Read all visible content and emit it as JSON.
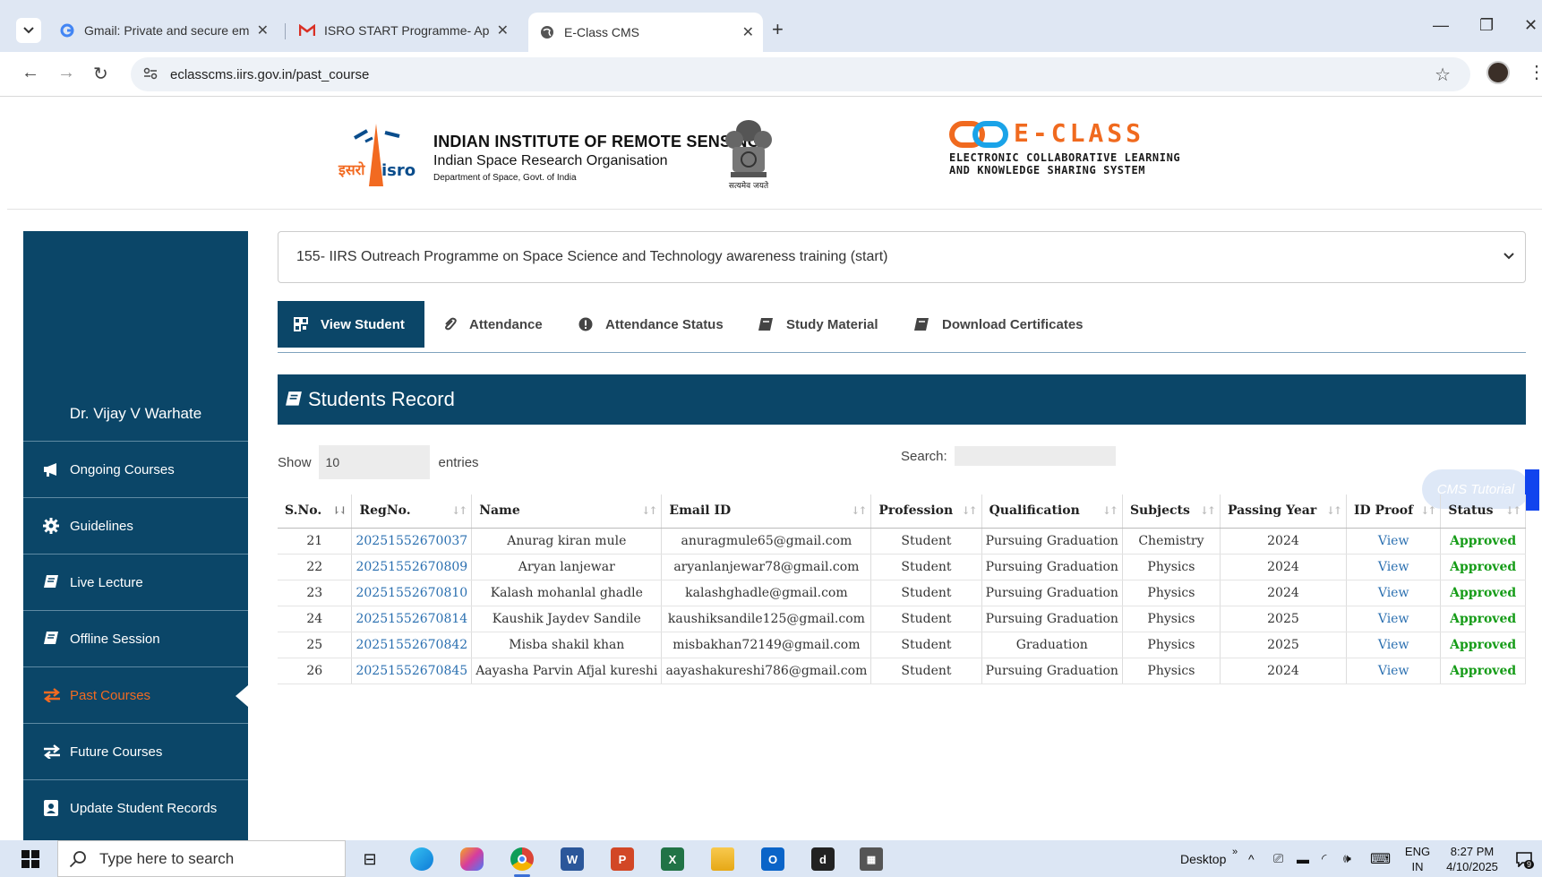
{
  "browser": {
    "tabs": [
      {
        "label": "Gmail: Private and secure email",
        "favicon": "google-icon"
      },
      {
        "label": "ISRO START Programme- Approval",
        "favicon": "gmail-icon"
      },
      {
        "label": "E-Class CMS",
        "favicon": "globe-icon"
      }
    ],
    "url": "eclasscms.iirs.gov.in/past_course"
  },
  "header": {
    "isro_hindi": "इसरो",
    "isro_latin": "isro",
    "institute": "INDIAN INSTITUTE OF REMOTE SENSING",
    "org": "Indian Space Research Organisation",
    "dept": "Department of Space, Govt. of India",
    "emblem_motto": "सत्यमेव जयते",
    "eclass_title": "E-CLASS",
    "eclass_sub1": "ELECTRONIC COLLABORATIVE LEARNING",
    "eclass_sub2": "AND KNOWLEDGE SHARING SYSTEM"
  },
  "sidebar": {
    "user": "Dr. Vijay V Warhate",
    "items": [
      {
        "label": "Ongoing Courses"
      },
      {
        "label": "Guidelines"
      },
      {
        "label": "Live Lecture"
      },
      {
        "label": "Offline Session"
      },
      {
        "label": "Past Courses"
      },
      {
        "label": "Future Courses"
      },
      {
        "label": "Update Student Records"
      }
    ]
  },
  "course_select": {
    "selected": "155- IIRS Outreach Programme on Space Science and Technology awareness training (start)"
  },
  "tabs": [
    {
      "label": "View Student"
    },
    {
      "label": "Attendance"
    },
    {
      "label": "Attendance Status"
    },
    {
      "label": "Study Material"
    },
    {
      "label": "Download Certificates"
    }
  ],
  "panel": {
    "title": "Students Record",
    "show_label": "Show",
    "entries_value": "10",
    "entries_label": "entries",
    "search_label": "Search:"
  },
  "cms_tutorial": "CMS Tutorial",
  "table": {
    "columns": [
      "S.No.",
      "RegNo.",
      "Name",
      "Email ID",
      "Profession",
      "Qualification",
      "Subjects",
      "Passing Year",
      "ID Proof",
      "Status"
    ],
    "rows": [
      [
        "21",
        "20251552670037",
        "Anurag kiran mule",
        "anuragmule65@gmail.com",
        "Student",
        "Pursuing Graduation",
        "Chemistry",
        "2024",
        "View",
        "Approved"
      ],
      [
        "22",
        "20251552670809",
        "Aryan lanjewar",
        "aryanlanjewar78@gmail.com",
        "Student",
        "Pursuing Graduation",
        "Physics",
        "2024",
        "View",
        "Approved"
      ],
      [
        "23",
        "20251552670810",
        "Kalash mohanlal ghadle",
        "kalashghadle@gmail.com",
        "Student",
        "Pursuing Graduation",
        "Physics",
        "2024",
        "View",
        "Approved"
      ],
      [
        "24",
        "20251552670814",
        "Kaushik Jaydev Sandile",
        "kaushiksandile125@gmail.com",
        "Student",
        "Pursuing Graduation",
        "Physics",
        "2025",
        "View",
        "Approved"
      ],
      [
        "25",
        "20251552670842",
        "Misba shakil khan",
        "misbakhan72149@gmail.com",
        "Student",
        "Graduation",
        "Physics",
        "2025",
        "View",
        "Approved"
      ],
      [
        "26",
        "20251552670845",
        "Aayasha Parvin Afjal kureshi",
        "aayashakureshi786@gmail.com",
        "Student",
        "Pursuing Graduation",
        "Physics",
        "2024",
        "View",
        "Approved"
      ]
    ]
  },
  "taskbar": {
    "search_placeholder": "Type here to search",
    "desktop_label": "Desktop",
    "lang_top": "ENG",
    "lang_bottom": "IN",
    "time": "8:27 PM",
    "date": "4/10/2025",
    "notif_count": "9"
  },
  "colors": {
    "primary": "#0b4668",
    "accent": "#f26a21",
    "approved": "#169c18",
    "link": "#2a6fb0"
  }
}
